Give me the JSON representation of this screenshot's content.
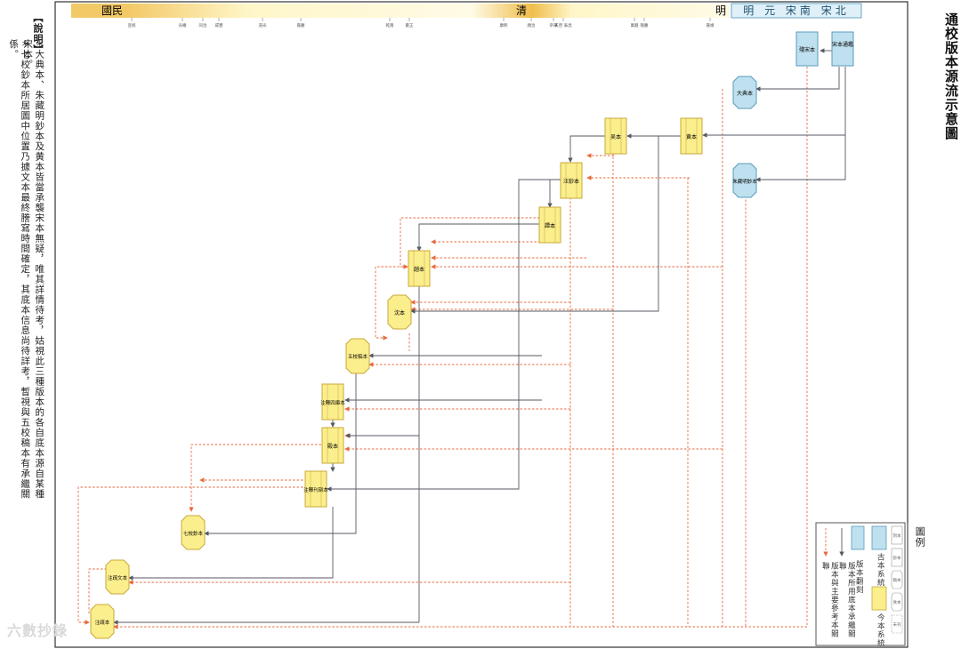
{
  "title": "通校版本源流示意圖",
  "notes": {
    "heading": "【說明】",
    "note1": "＊大典本、朱藏明鈔本及黄本皆當承襲宋本無疑，唯其詳情待考，姑視此三種版本的各自底本源自某種宋本。",
    "note2": "＊七校鈔本所居圖中位置乃據文本最終謄寫時間確定，其底本信息尚待詳考，暫視與五校稿本有承繼關係。"
  },
  "eras": [
    {
      "label": "國民"
    },
    {
      "label": "清"
    },
    {
      "label": "明"
    },
    {
      "label": "明 元 宋南 宋北"
    }
  ],
  "reigns": [
    "宣統",
    "光緒",
    "同治",
    "咸豐",
    "道光",
    "嘉慶",
    "乾隆",
    "雍正",
    "康熙",
    "順治",
    "崇禎",
    "天啓 泰昌",
    "萬曆",
    "隆慶",
    "嘉靖"
  ],
  "nodes": {
    "song_tonglun": "宋本通鑑",
    "song_zhi": "殘宋本",
    "dadian": "大典本",
    "zhucang": "朱藏明鈔本",
    "huang": "黄本",
    "wu": "吴本",
    "wangchao": "汪鈔本",
    "tan": "譚本",
    "zhao": "趙本",
    "shen": "沈本",
    "wujiaogao": "五校稿本",
    "zhushusi": "注釋四庫本",
    "dian": "殿本",
    "zhushukan": "注釋刊刻本",
    "qijiaochao": "七校鈔本",
    "zhujiwen": "注疏文本",
    "zhubei": "注疏本"
  },
  "legend": {
    "title": "圖例",
    "ancient": "古本系統",
    "modern": "今本系統",
    "copy": "版本翻刻",
    "inherit": "版本所用底本承繼關聯",
    "reference": "版本與主要參考本關聯",
    "chip1": "刻本",
    "chip2": "鈔本",
    "chip3": "稿本",
    "chip4": "佚本",
    "chip5": "未刊"
  },
  "colors": {
    "modern_fill": "#fbee8c",
    "ancient_fill": "#bfe0ee",
    "reference_line": "#e8693c",
    "inherit_line": "#555a63"
  },
  "watermark": "六數抄錄"
}
